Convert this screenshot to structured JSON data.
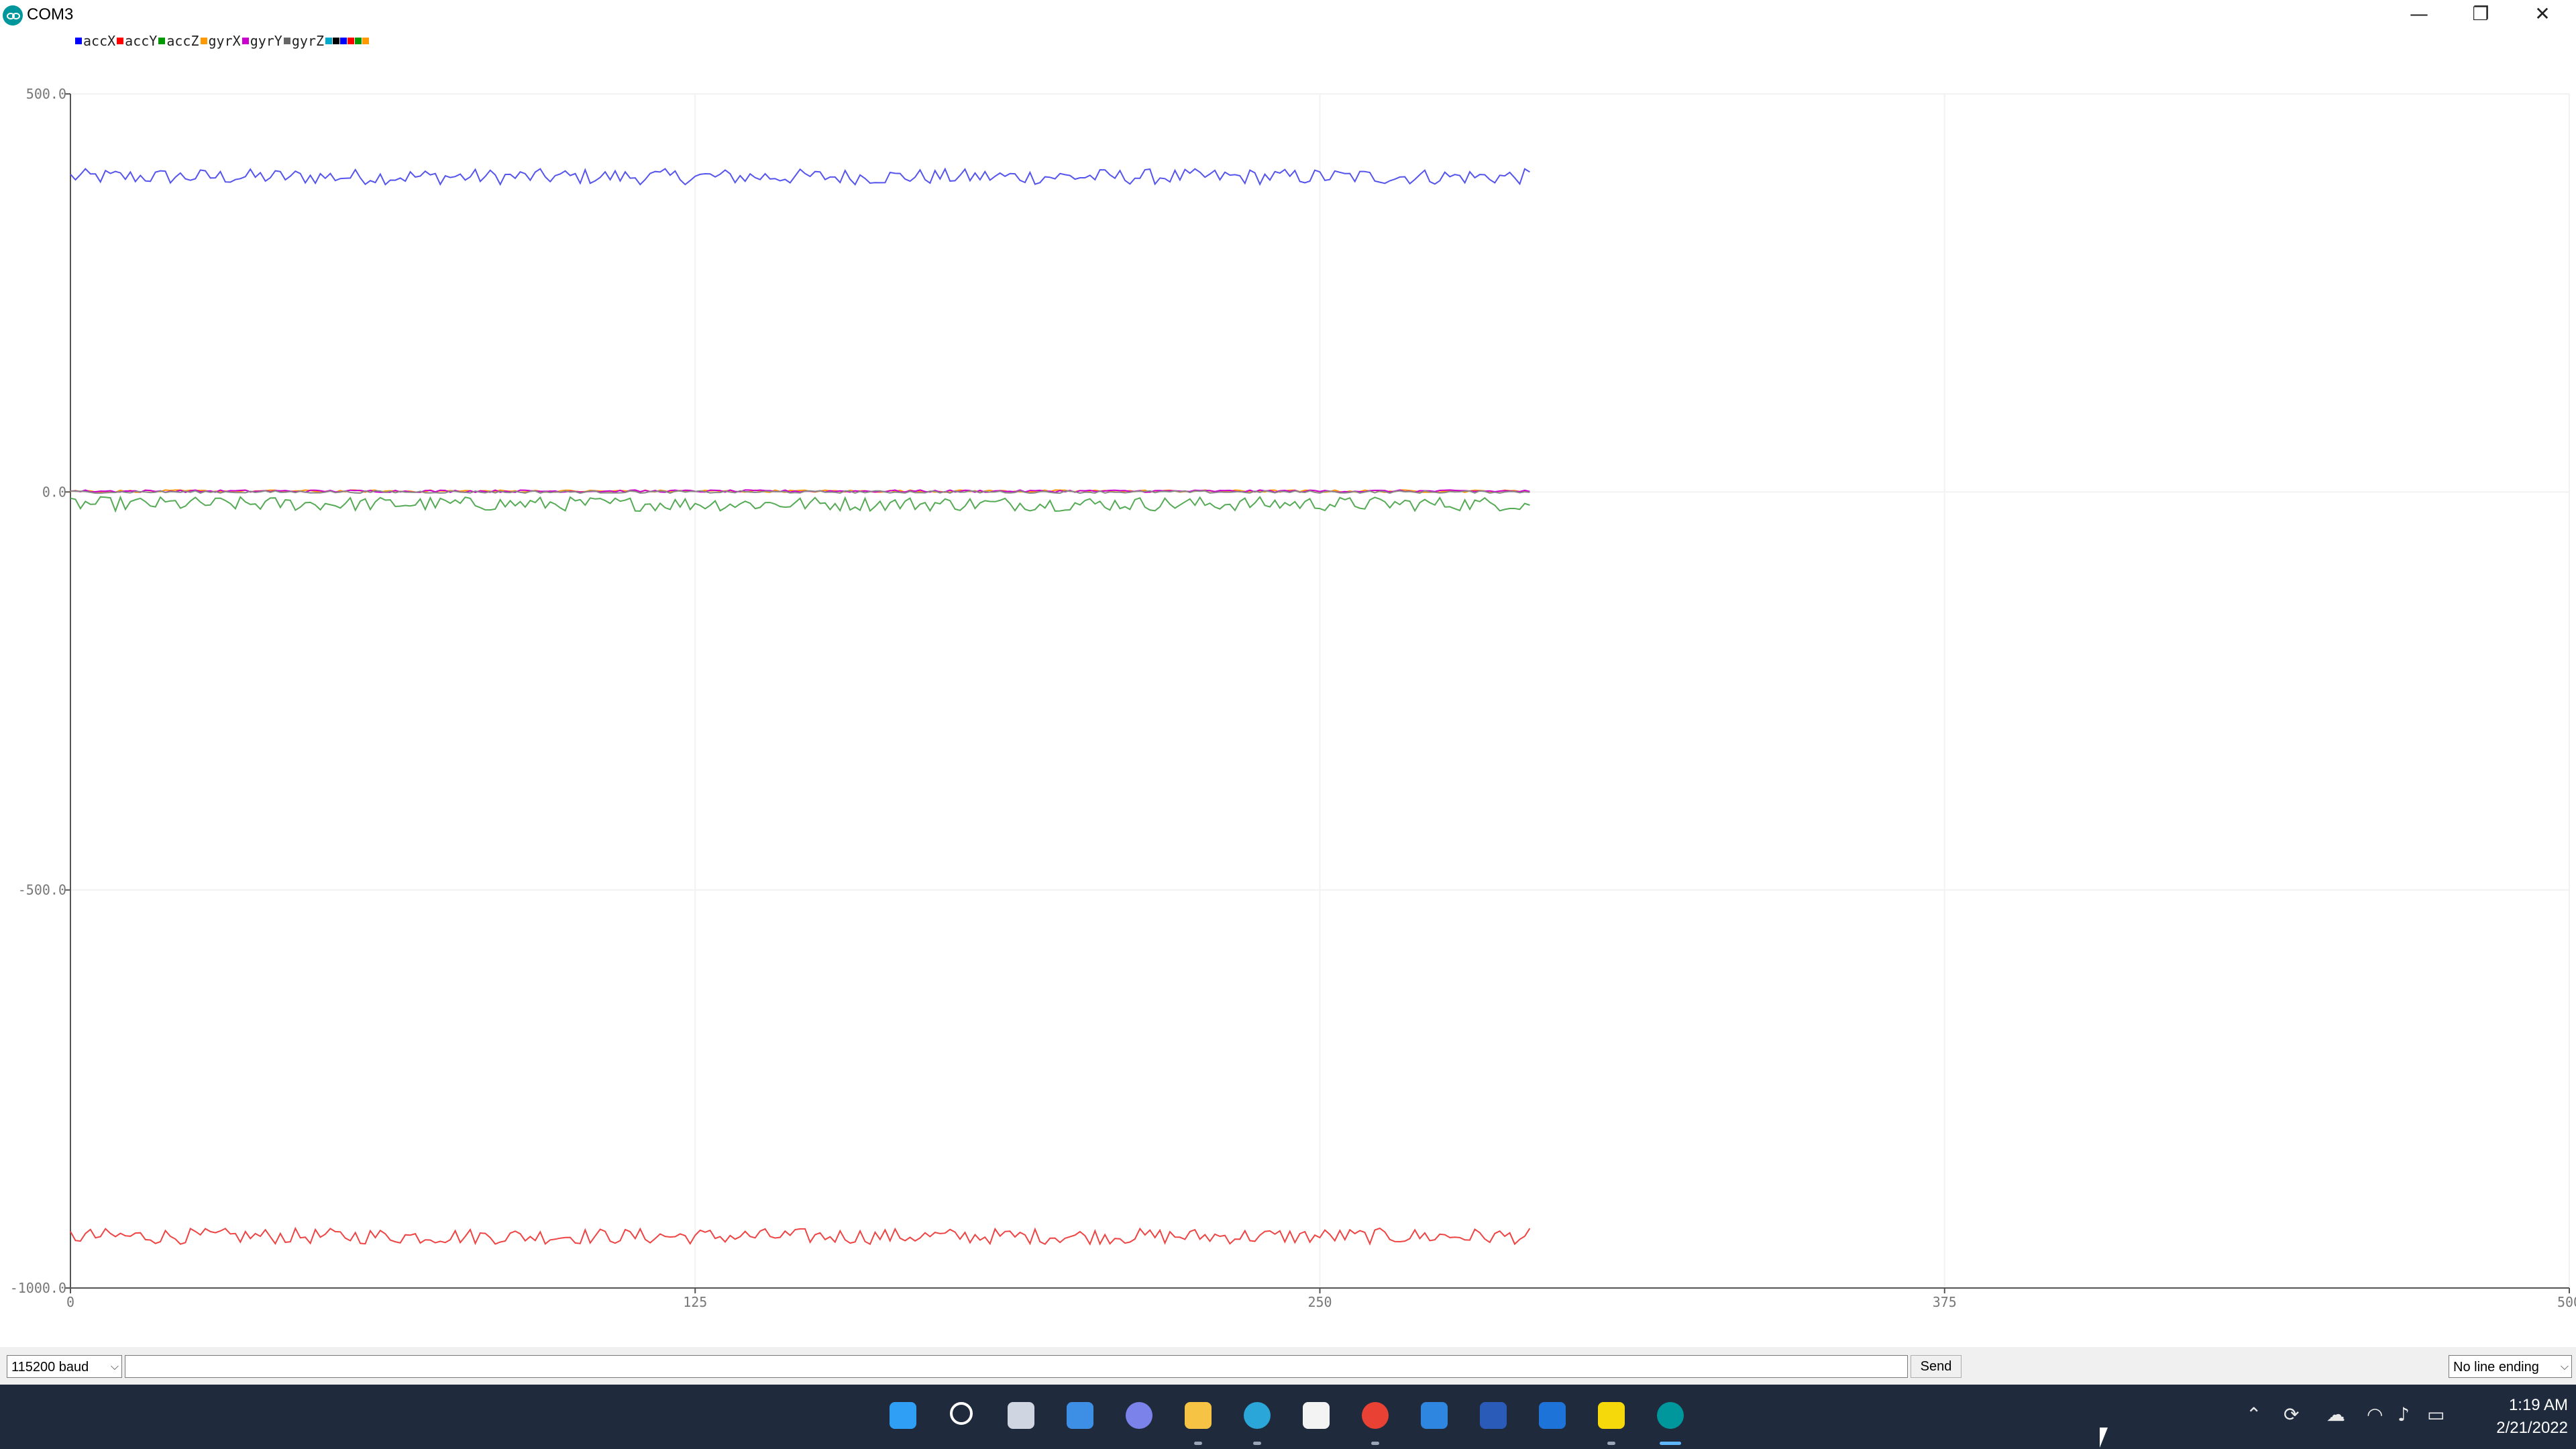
{
  "window": {
    "title": "COM3"
  },
  "titlebar_buttons": {
    "minimize": "—",
    "maximize": "❐",
    "close": "✕"
  },
  "legend": {
    "items": [
      {
        "label": "accX",
        "color": "#0000ff"
      },
      {
        "label": "accY",
        "color": "#ff0000"
      },
      {
        "label": "accZ",
        "color": "#009900"
      },
      {
        "label": "gyrX",
        "color": "#ff9900"
      },
      {
        "label": "gyrY",
        "color": "#cc00cc"
      },
      {
        "label": "gyrZ",
        "color": "#666666"
      }
    ],
    "extra_swatches": [
      "#00aacc",
      "#000000",
      "#0000ff",
      "#ff0000",
      "#009900",
      "#ff9900"
    ]
  },
  "chart_data": {
    "type": "line",
    "xlim": [
      0,
      500
    ],
    "ylim": [
      -1000,
      500
    ],
    "x_ticks": [
      "0",
      "125",
      "250",
      "375",
      "500"
    ],
    "y_ticks": [
      "500.0",
      "0.0",
      "-500.0",
      "-1000.0"
    ],
    "x_tick_values": [
      0,
      125,
      250,
      375,
      500
    ],
    "y_tick_values": [
      500,
      0,
      -500,
      -1000
    ],
    "samples": 293,
    "grid": true,
    "legend_position": "top-left",
    "series": [
      {
        "name": "accX",
        "color": "#5555ee",
        "mean": 396,
        "amplitude": 10
      },
      {
        "name": "accY",
        "color": "#ee4444",
        "mean": -935,
        "amplitude": 10
      },
      {
        "name": "accZ",
        "color": "#55aa55",
        "mean": -15,
        "amplitude": 9
      },
      {
        "name": "gyrX",
        "color": "#ff9900",
        "mean": 1,
        "amplitude": 1.5
      },
      {
        "name": "gyrY",
        "color": "#cc00cc",
        "mean": 1,
        "amplitude": 1.5
      },
      {
        "name": "gyrZ",
        "color": "#888888",
        "mean": 0,
        "amplitude": 1.5
      }
    ]
  },
  "bottom": {
    "baud": "115200 baud",
    "send_value": "",
    "send_label": "Send",
    "line_ending": "No line ending"
  },
  "taskbar": {
    "apps": [
      {
        "name": "start-icon",
        "color": "#2f9ff5"
      },
      {
        "name": "search-icon",
        "color": "#ffffff"
      },
      {
        "name": "task-view-icon",
        "color": "#cfd6e2"
      },
      {
        "name": "widgets-icon",
        "color": "#3d8fe6"
      },
      {
        "name": "teams-chat-icon",
        "color": "#7b83eb"
      },
      {
        "name": "file-explorer-icon",
        "color": "#f6c344"
      },
      {
        "name": "edge-icon",
        "color": "#2aa6d8"
      },
      {
        "name": "store-icon",
        "color": "#f3f3f3"
      },
      {
        "name": "chrome-icon",
        "color": "#e94235"
      },
      {
        "name": "mail-icon",
        "color": "#2f86e0"
      },
      {
        "name": "word-icon",
        "color": "#2b5bb8"
      },
      {
        "name": "outlook-icon",
        "color": "#1e73d8"
      },
      {
        "name": "sticky-notes-icon",
        "color": "#f5d90a"
      },
      {
        "name": "arduino-icon",
        "color": "#00979c"
      }
    ],
    "time": "1:19 AM",
    "date": "2/21/2022"
  }
}
